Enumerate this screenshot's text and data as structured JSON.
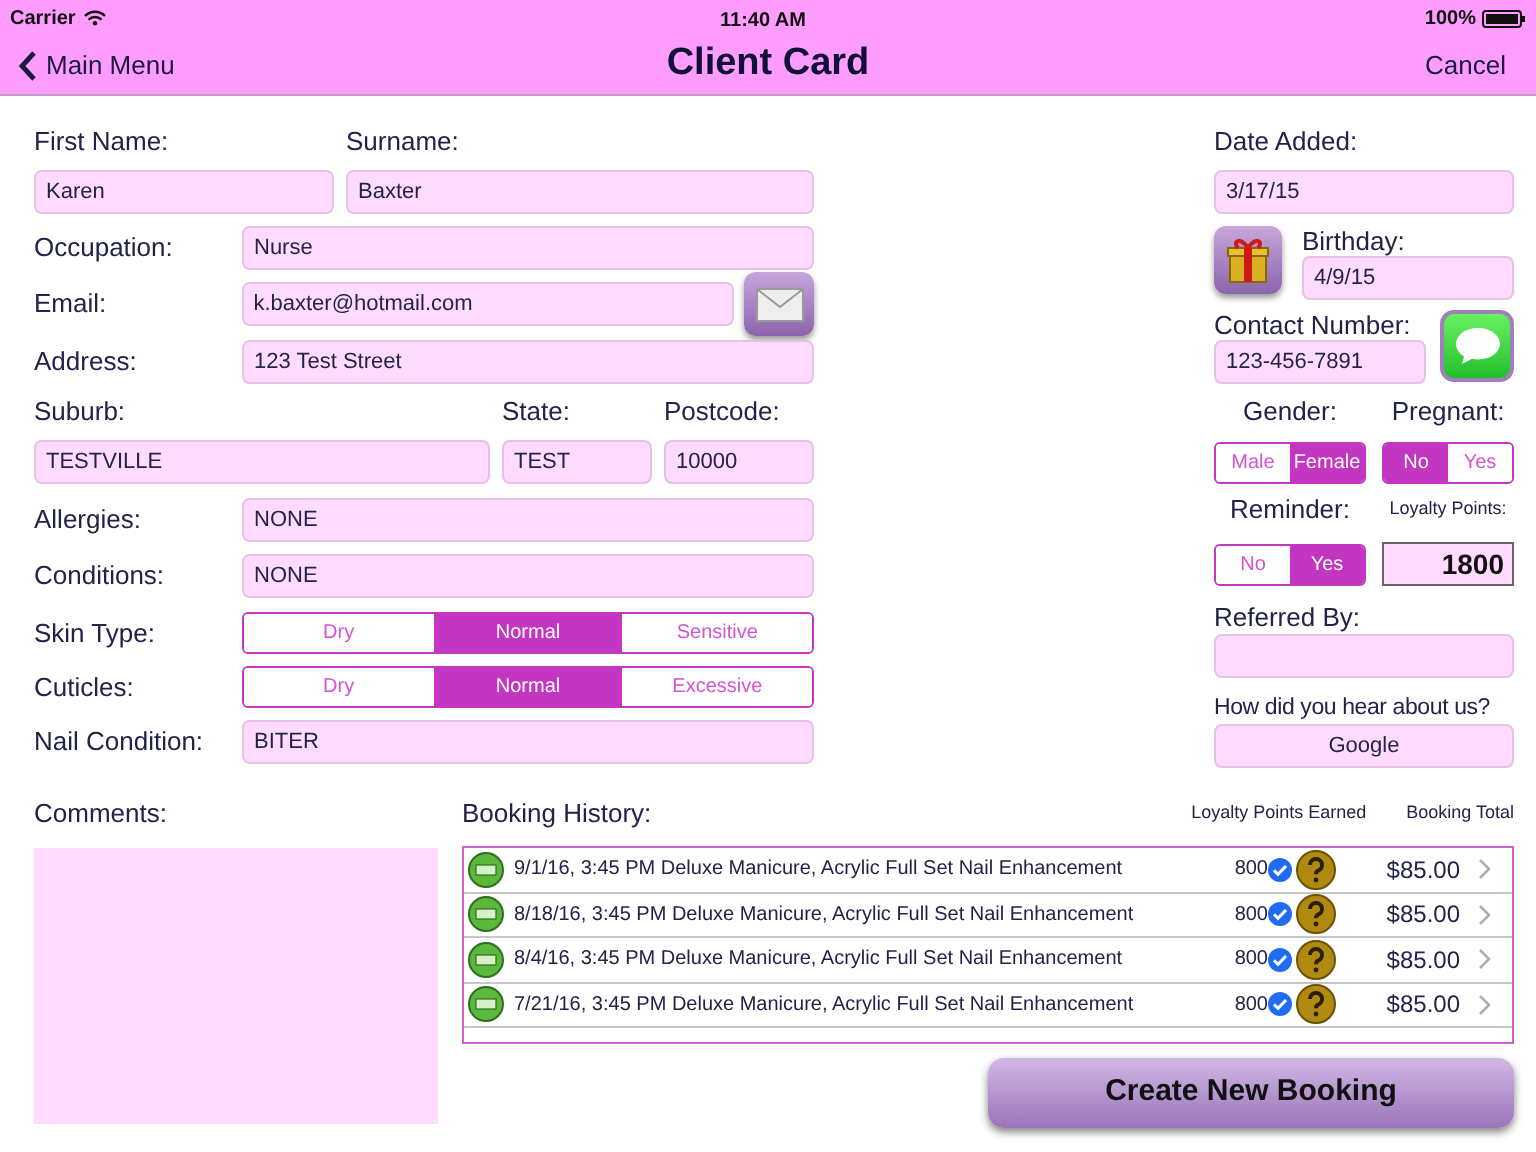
{
  "status_bar": {
    "carrier": "Carrier",
    "time": "11:40 AM",
    "battery": "100%"
  },
  "nav_bar": {
    "back": "Main Menu",
    "title": "Client Card",
    "action": "Cancel"
  },
  "first_name": {
    "label": "First Name:",
    "value": "Karen"
  },
  "surname": {
    "label": "Surname:",
    "value": "Baxter"
  },
  "occupation": {
    "label": "Occupation:",
    "value": "Nurse"
  },
  "email": {
    "label": "Email:",
    "value": "k.baxter@hotmail.com"
  },
  "address": {
    "label": "Address:",
    "value": "123 Test Street"
  },
  "suburb": {
    "label": "Suburb:",
    "value": "TESTVILLE"
  },
  "state": {
    "label": "State:",
    "value": "TEST"
  },
  "postcode": {
    "label": "Postcode:",
    "value": "10000"
  },
  "allergies": {
    "label": "Allergies:",
    "value": "NONE"
  },
  "conditions": {
    "label": "Conditions:",
    "value": "NONE"
  },
  "skin_type": {
    "label": "Skin Type:",
    "options": [
      {
        "label": "Dry",
        "selected": false
      },
      {
        "label": "Normal",
        "selected": true
      },
      {
        "label": "Sensitive",
        "selected": false
      }
    ]
  },
  "cuticles": {
    "label": "Cuticles:",
    "options": [
      {
        "label": "Dry",
        "selected": false
      },
      {
        "label": "Normal",
        "selected": true
      },
      {
        "label": "Excessive",
        "selected": false
      }
    ]
  },
  "nail_condition": {
    "label": "Nail Condition:",
    "value": "BITER"
  },
  "date_added": {
    "label": "Date Added:",
    "value": "3/17/15"
  },
  "birthday": {
    "label": "Birthday:",
    "value": "4/9/15"
  },
  "contact_number": {
    "label": "Contact Number:",
    "value": "123-456-7891"
  },
  "gender": {
    "label": "Gender:",
    "options": [
      {
        "label": "Male",
        "selected": false
      },
      {
        "label": "Female",
        "selected": true
      }
    ]
  },
  "pregnant": {
    "label": "Pregnant:",
    "options": [
      {
        "label": "No",
        "selected": true
      },
      {
        "label": "Yes",
        "selected": false
      }
    ]
  },
  "reminder": {
    "label": "Reminder:",
    "options": [
      {
        "label": "No",
        "selected": false
      },
      {
        "label": "Yes",
        "selected": true
      }
    ]
  },
  "loyalty_points": {
    "label": "Loyalty Points:",
    "value": "1800"
  },
  "referred_by": {
    "label": "Referred By:"
  },
  "heard_about": {
    "label": "How did you hear about us?",
    "value": "Google"
  },
  "comments": {
    "label": "Comments:"
  },
  "booking_history": {
    "label": "Booking History:",
    "columns": [
      "Loyalty Points Earned",
      "Booking Total"
    ],
    "rows": [
      {
        "description": "9/1/16, 3:45 PM Deluxe Manicure, Acrylic Full Set Nail Enhancement",
        "points": "800",
        "total": "$85.00"
      },
      {
        "description": "8/18/16, 3:45 PM Deluxe Manicure, Acrylic Full Set Nail Enhancement",
        "points": "800",
        "total": "$85.00"
      },
      {
        "description": "8/4/16, 3:45 PM Deluxe Manicure, Acrylic Full Set Nail Enhancement",
        "points": "800",
        "total": "$85.00"
      },
      {
        "description": "7/21/16, 3:45 PM Deluxe Manicure, Acrylic Full Set Nail Enhancement",
        "points": "800",
        "total": "$85.00"
      }
    ]
  },
  "create_button": "Create New Booking"
}
